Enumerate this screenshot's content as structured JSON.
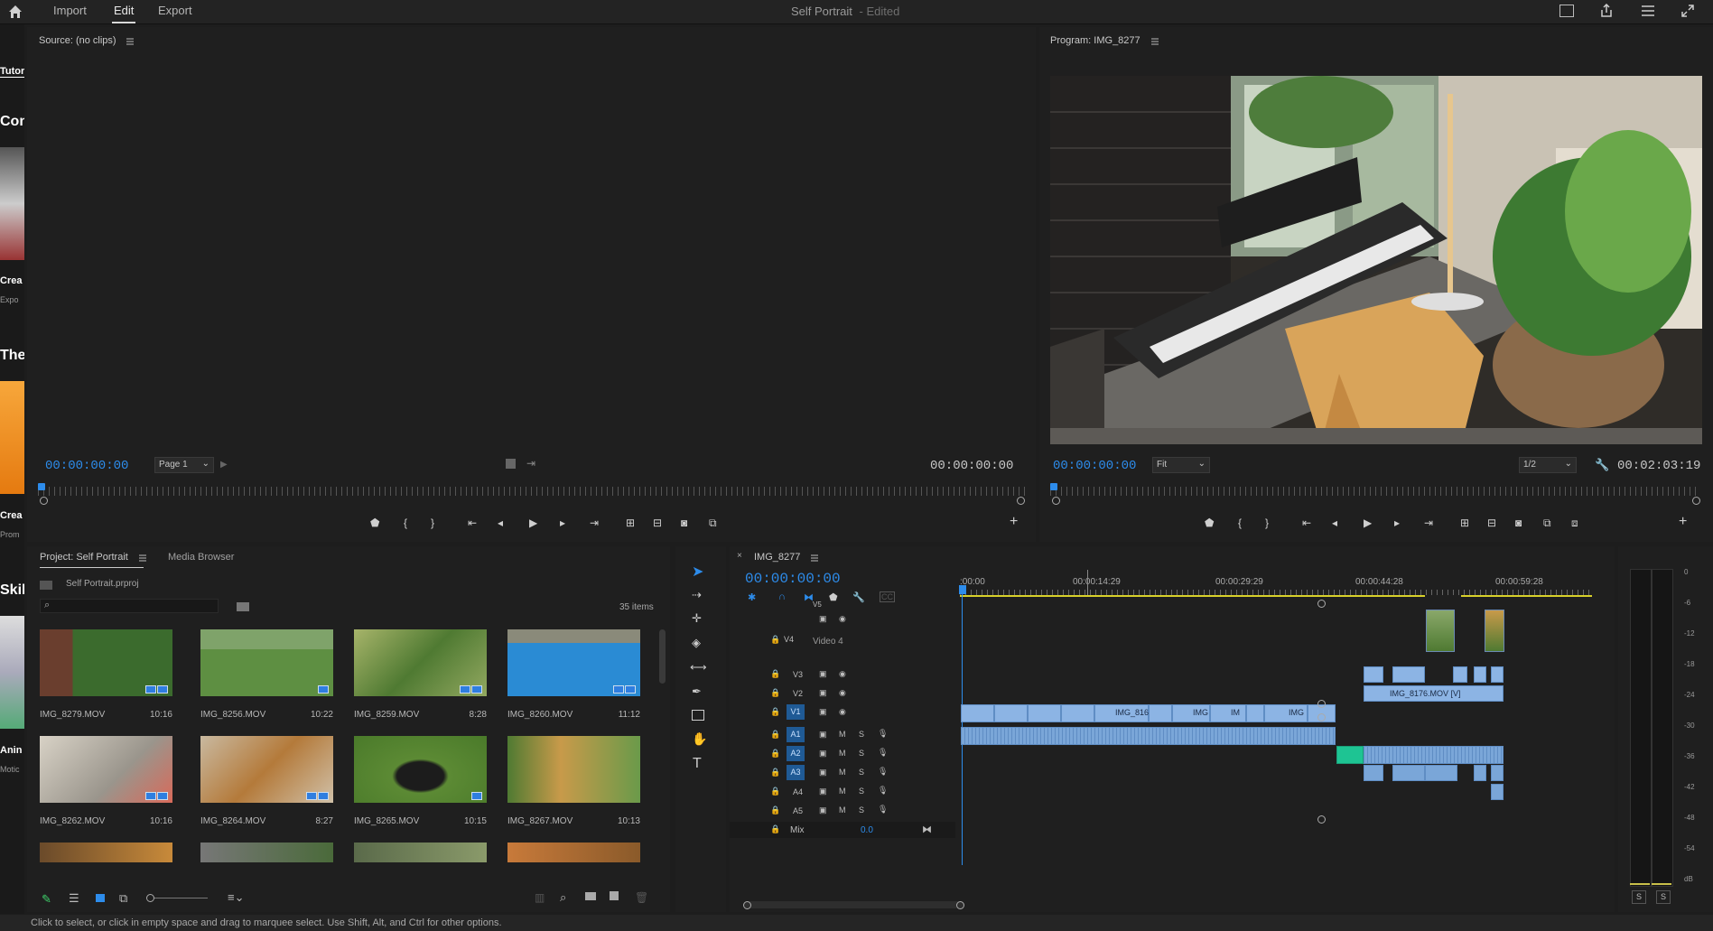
{
  "topbar": {
    "nav": [
      "Import",
      "Edit",
      "Export"
    ],
    "title": "Self Portrait",
    "title_status": "- Edited"
  },
  "left_strip": {
    "labels": [
      "Tutor",
      "Con",
      "Crea",
      "Expo",
      "The",
      "Crea",
      "Prom",
      "Skil",
      "Anin",
      "Motic"
    ]
  },
  "source_monitor": {
    "title": "Source: (no clips)",
    "timecode_left": "00:00:00:00",
    "page": "Page 1",
    "timecode_right": "00:00:00:00"
  },
  "program_monitor": {
    "title": "Program: IMG_8277",
    "timecode_left": "00:00:00:00",
    "fit": "Fit",
    "resolution": "1/2",
    "timecode_right": "00:02:03:19"
  },
  "project": {
    "tab_active": "Project: Self Portrait",
    "tab_other": "Media Browser",
    "file": "Self Portrait.prproj",
    "item_count": "35 items",
    "clips": [
      {
        "name": "IMG_8279.MOV",
        "duration": "10:16"
      },
      {
        "name": "IMG_8256.MOV",
        "duration": "10:22"
      },
      {
        "name": "IMG_8259.MOV",
        "duration": "8:28"
      },
      {
        "name": "IMG_8260.MOV",
        "duration": "11:12"
      },
      {
        "name": "IMG_8262.MOV",
        "duration": "10:16"
      },
      {
        "name": "IMG_8264.MOV",
        "duration": "8:27"
      },
      {
        "name": "IMG_8265.MOV",
        "duration": "10:15"
      },
      {
        "name": "IMG_8267.MOV",
        "duration": "10:13"
      }
    ]
  },
  "timeline": {
    "sequence": "IMG_8277",
    "timecode": "00:00:00:00",
    "ruler": [
      ":00:00",
      "00:00:14:29",
      "00:00:29:29",
      "00:00:44:28",
      "00:00:59:28"
    ],
    "tracks": {
      "v5": "V5",
      "v4": "V4",
      "v4_name": "Video 4",
      "v3": "V3",
      "v2": "V2",
      "v1": "V1",
      "a1": "A1",
      "a2": "A2",
      "a3": "A3",
      "a4": "A4",
      "a5": "A5",
      "mix": "Mix",
      "mix_value": "0.0"
    },
    "v1_clip_labels": [
      "IMG_816",
      "IMG",
      "IM",
      "IMG"
    ],
    "v2_clip_label": "IMG_8176.MOV [V]"
  },
  "meter": {
    "scale": [
      "0",
      "-6",
      "-12",
      "-18",
      "-24",
      "-30",
      "-36",
      "-42",
      "-48",
      "-54",
      "dB"
    ],
    "solo": [
      "S",
      "S"
    ]
  },
  "status": {
    "text": "Click to select, or click in empty space and drag to marquee select. Use Shift, Alt, and Ctrl for other options."
  }
}
